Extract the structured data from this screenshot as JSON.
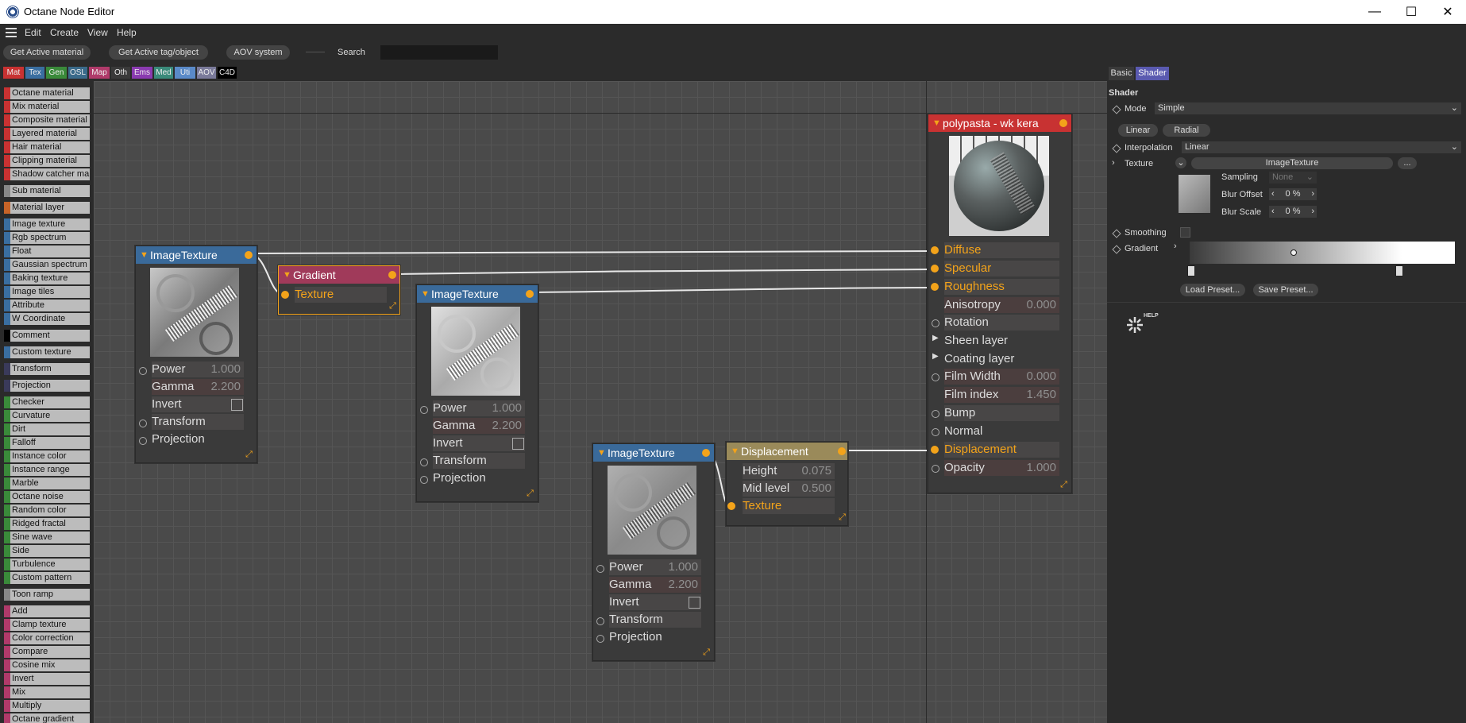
{
  "window": {
    "title": "Octane Node Editor"
  },
  "menu": [
    "Edit",
    "Create",
    "View",
    "Help"
  ],
  "toolbar": {
    "buttons": [
      "Get Active material",
      "Get Active tag/object",
      "AOV system"
    ],
    "search_label": "Search",
    "search_value": ""
  },
  "categories": [
    {
      "label": "Mat",
      "color": "#c83232"
    },
    {
      "label": "Tex",
      "color": "#3a6ea0"
    },
    {
      "label": "Gen",
      "color": "#3a8a3a"
    },
    {
      "label": "OSL",
      "color": "#3a6a8a"
    },
    {
      "label": "Map",
      "color": "#b03a6a"
    },
    {
      "label": "Oth",
      "color": "#3a3a3a"
    },
    {
      "label": "Ems",
      "color": "#8a3ab0"
    },
    {
      "label": "Med",
      "color": "#3a8a7a"
    },
    {
      "label": "Uti",
      "color": "#5a8ac8"
    },
    {
      "label": "AOV",
      "color": "#7a7a9a"
    },
    {
      "label": "C4D",
      "color": "#000000"
    }
  ],
  "palette": [
    {
      "label": "Octane material",
      "color": "#c83232"
    },
    {
      "label": "Mix material",
      "color": "#c83232"
    },
    {
      "label": "Composite material",
      "color": "#c83232"
    },
    {
      "label": "Layered material",
      "color": "#c83232"
    },
    {
      "label": "Hair material",
      "color": "#c83232"
    },
    {
      "label": "Clipping material",
      "color": "#c83232"
    },
    {
      "label": "Shadow catcher ma",
      "color": "#c83232"
    },
    {
      "label": "Sub material",
      "color": "#888888"
    },
    {
      "label": "Material layer",
      "color": "#c86428"
    },
    {
      "label": "Image texture",
      "color": "#3a6ea0"
    },
    {
      "label": "Rgb spectrum",
      "color": "#3a6ea0"
    },
    {
      "label": "Float",
      "color": "#3a6ea0"
    },
    {
      "label": "Gaussian spectrum",
      "color": "#3a6ea0"
    },
    {
      "label": "Baking texture",
      "color": "#3a6ea0"
    },
    {
      "label": "Image tiles",
      "color": "#3a6ea0"
    },
    {
      "label": "Attribute",
      "color": "#3a6ea0"
    },
    {
      "label": "W Coordinate",
      "color": "#3a6ea0"
    },
    {
      "label": "Comment",
      "color": "#000000"
    },
    {
      "label": "Custom texture",
      "color": "#3a6ea0"
    },
    {
      "label": "Transform",
      "color": "#3a3a5a"
    },
    {
      "label": "Projection",
      "color": "#3a3a5a"
    },
    {
      "label": "Checker",
      "color": "#3a8a3a"
    },
    {
      "label": "Curvature",
      "color": "#3a8a3a"
    },
    {
      "label": "Dirt",
      "color": "#3a8a3a"
    },
    {
      "label": "Falloff",
      "color": "#3a8a3a"
    },
    {
      "label": "Instance color",
      "color": "#3a8a3a"
    },
    {
      "label": "Instance range",
      "color": "#3a8a3a"
    },
    {
      "label": "Marble",
      "color": "#3a8a3a"
    },
    {
      "label": "Octane noise",
      "color": "#3a8a3a"
    },
    {
      "label": "Random color",
      "color": "#3a8a3a"
    },
    {
      "label": "Ridged fractal",
      "color": "#3a8a3a"
    },
    {
      "label": "Sine wave",
      "color": "#3a8a3a"
    },
    {
      "label": "Side",
      "color": "#3a8a3a"
    },
    {
      "label": "Turbulence",
      "color": "#3a8a3a"
    },
    {
      "label": "Custom pattern",
      "color": "#3a8a3a"
    },
    {
      "label": "Toon ramp",
      "color": "#888888"
    },
    {
      "label": "Add",
      "color": "#b03a6a"
    },
    {
      "label": "Clamp texture",
      "color": "#b03a6a"
    },
    {
      "label": "Color correction",
      "color": "#b03a6a"
    },
    {
      "label": "Compare",
      "color": "#b03a6a"
    },
    {
      "label": "Cosine mix",
      "color": "#b03a6a"
    },
    {
      "label": "Invert",
      "color": "#b03a6a"
    },
    {
      "label": "Mix",
      "color": "#b03a6a"
    },
    {
      "label": "Multiply",
      "color": "#b03a6a"
    },
    {
      "label": "Octane gradient",
      "color": "#b03a6a"
    }
  ],
  "nodes": {
    "img1": {
      "title": "ImageTexture",
      "power_label": "Power",
      "power": "1.000",
      "gamma_label": "Gamma",
      "gamma": "2.200",
      "invert_label": "Invert",
      "transform_label": "Transform",
      "projection_label": "Projection"
    },
    "gradient": {
      "title": "Gradient",
      "texture_label": "Texture"
    },
    "img2": {
      "title": "ImageTexture",
      "power_label": "Power",
      "power": "1.000",
      "gamma_label": "Gamma",
      "gamma": "2.200",
      "invert_label": "Invert",
      "transform_label": "Transform",
      "projection_label": "Projection"
    },
    "img3": {
      "title": "ImageTexture",
      "power_label": "Power",
      "power": "1.000",
      "gamma_label": "Gamma",
      "gamma": "2.200",
      "invert_label": "Invert",
      "transform_label": "Transform",
      "projection_label": "Projection"
    },
    "displacement": {
      "title": "Displacement",
      "height_label": "Height",
      "height": "0.075",
      "mid_label": "Mid level",
      "mid": "0.500",
      "texture_label": "Texture"
    },
    "material": {
      "title": "polypasta - wk kera",
      "diffuse": "Diffuse",
      "specular": "Specular",
      "roughness": "Roughness",
      "anisotropy": "Anisotropy",
      "anisotropy_val": "0.000",
      "rotation": "Rotation",
      "sheen": "Sheen layer",
      "coating": "Coating layer",
      "film_width": "Film Width",
      "film_width_val": "0.000",
      "film_index": "Film index",
      "film_index_val": "1.450",
      "bump": "Bump",
      "normal": "Normal",
      "displacement": "Displacement",
      "opacity": "Opacity",
      "opacity_val": "1.000"
    }
  },
  "panel": {
    "tabs": [
      "Basic",
      "Shader"
    ],
    "section": "Shader",
    "mode_label": "Mode",
    "mode_value": "Simple",
    "linear_btn": "Linear",
    "radial_btn": "Radial",
    "interp_label": "Interpolation",
    "interp_value": "Linear",
    "texture_label": "Texture",
    "texture_value": "ImageTexture",
    "more_btn": "...",
    "sampling_label": "Sampling",
    "sampling_value": "None",
    "blur_offset_label": "Blur Offset",
    "blur_offset_value": "0 %",
    "blur_scale_label": "Blur Scale",
    "blur_scale_value": "0 %",
    "smoothing_label": "Smoothing",
    "gradient_label": "Gradient",
    "load_preset": "Load Preset...",
    "save_preset": "Save Preset...",
    "help_label": "HELP"
  }
}
